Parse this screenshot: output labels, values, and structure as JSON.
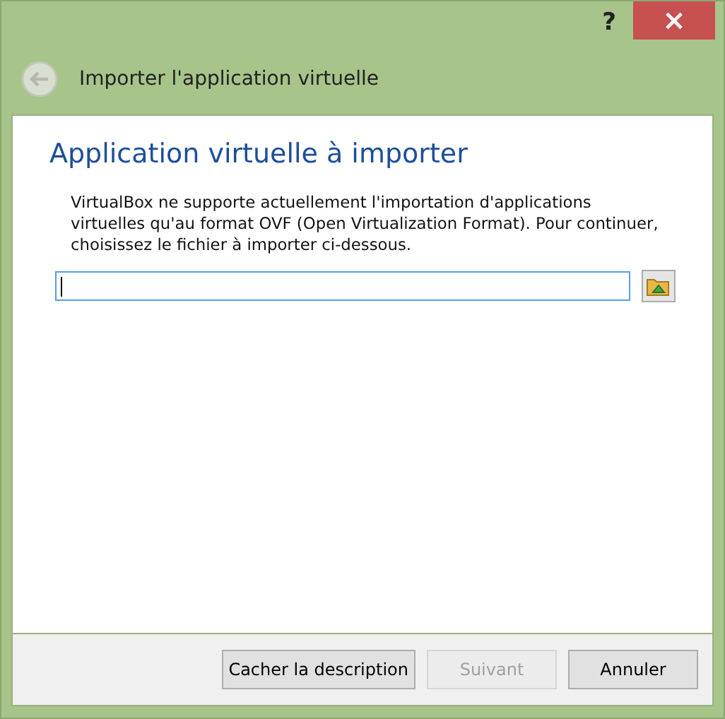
{
  "window": {
    "help": "?",
    "close": "×"
  },
  "header": {
    "title": "Importer l'application virtuelle",
    "back_disabled": true
  },
  "page": {
    "heading": "Application virtuelle à importer",
    "description": "VirtualBox ne supporte actuellement l'importation d'applications virtuelles qu'au format OVF (Open Virtualization Format). Pour continuer, choisissez le fichier à importer ci-dessous.",
    "file_field": {
      "focused": true
    }
  },
  "buttons": [
    {
      "label": "Cacher la description",
      "disabled": false
    },
    {
      "label": "Suivant",
      "disabled": true
    },
    {
      "label": "Annuler",
      "disabled": false
    }
  ]
}
